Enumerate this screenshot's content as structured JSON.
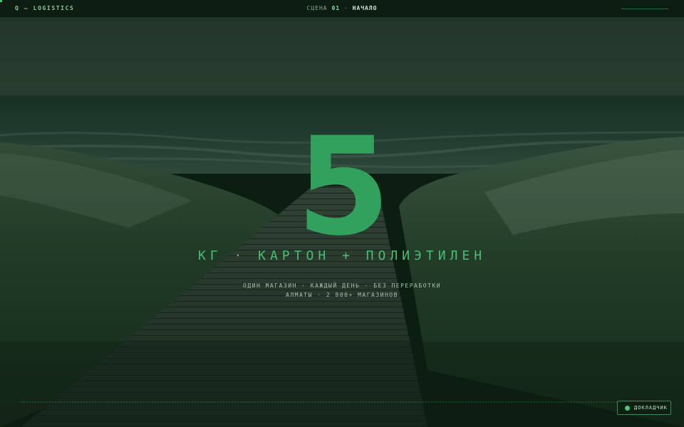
{
  "header": {
    "brand": "Q — LOGISTICS",
    "scene_prefix": "СЦЕНА",
    "scene_number": "01",
    "scene_separator": "·",
    "scene_name": "НАЧАЛО"
  },
  "hero": {
    "number": "5",
    "headline": "КГ · КАРТОН + ПОЛИЭТИЛЕН",
    "sub_line_1": "ОДИН МАГАЗИН · КАЖДЫЙ ДЕНЬ · БЕЗ ПЕРЕРАБОТКИ",
    "sub_line_2": "АЛМАТЫ · 2 800+ МАГАЗИНОВ"
  },
  "speaker_button": {
    "label": "ДОКЛАДЧИК",
    "icon": "status-dot-icon"
  },
  "colors": {
    "accent": "#31a15d",
    "accent_light": "#4bbd73",
    "topbar_bg": "#0d1d12"
  }
}
